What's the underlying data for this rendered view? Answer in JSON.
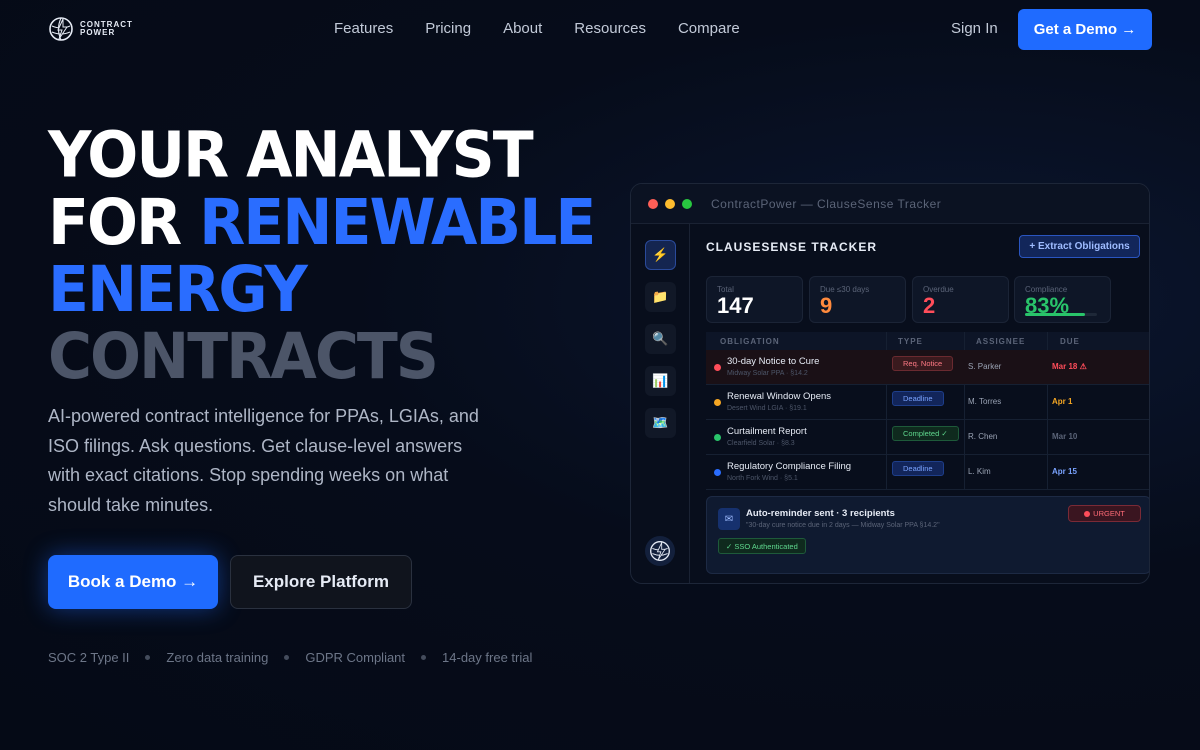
{
  "brand": {
    "line1": "CONTRACT",
    "line2": "POWER"
  },
  "nav": {
    "links": [
      "Features",
      "Pricing",
      "About",
      "Resources",
      "Compare"
    ],
    "sign_in": "Sign In",
    "demo_cta": "Get a Demo →"
  },
  "hero": {
    "line1": "YOUR ANALYST",
    "line2_a": "FOR ",
    "line2_b": "RENEWABLE",
    "line3": "ENERGY",
    "line4": "CONTRACTS",
    "subtext": "AI-powered contract intelligence for PPAs, LGIAs, and ISO filings. Ask questions. Get clause-level answers with exact citations. Stop spending weeks on what should take minutes.",
    "primary_cta": "Book a Demo →",
    "secondary_cta": "Explore Platform",
    "trust": [
      "SOC 2 Type II",
      "Zero data training",
      "GDPR Compliant",
      "14-day free trial"
    ]
  },
  "colors": {
    "accent": "#1f6bff",
    "danger": "#ff4d5a",
    "warning": "#f5a623",
    "success": "#29c46a"
  },
  "mockup": {
    "window_title": "ContractPower — ClauseSense Tracker",
    "sidebar_icons": [
      "lightning-icon",
      "folder-icon",
      "search-icon",
      "chart-icon",
      "map-icon"
    ],
    "sidebar_glyphs": [
      "⚡",
      "📁",
      "🔍",
      "📊",
      "🗺️"
    ],
    "title": "CLAUSESENSE TRACKER",
    "extract_button": "+ Extract Obligations",
    "stats": [
      {
        "label": "Total",
        "value": "147",
        "color": "#ffffff"
      },
      {
        "label": "Due ≤30 days",
        "value": "9",
        "color": "#ff8a3d"
      },
      {
        "label": "Overdue",
        "value": "2",
        "color": "#ff4d5a"
      },
      {
        "label": "Compliance",
        "value": "83%",
        "color": "#29c46a",
        "progress": 0.83
      }
    ],
    "columns": [
      "OBLIGATION",
      "TYPE",
      "ASSIGNEE",
      "DUE"
    ],
    "rows": [
      {
        "title": "30-day Notice to Cure",
        "sub": "Midway Solar PPA · §14.2",
        "type": "Req. Notice",
        "assignee": "S. Parker",
        "due": "Mar 18 ⚠",
        "dot": "#ff4d5a",
        "tag_bg": "#3a1a1e",
        "tag_border": "#6a2a30",
        "tag_fg": "#ff7a85",
        "due_color": "#ff4d5a",
        "highlight": true
      },
      {
        "title": "Renewal Window Opens",
        "sub": "Desert Wind LGIA · §19.1",
        "type": "Deadline",
        "assignee": "M. Torres",
        "due": "Apr 1",
        "dot": "#f5a623",
        "tag_bg": "#12255a",
        "tag_border": "#1e3e8a",
        "tag_fg": "#7aa3ff",
        "due_color": "#f5a623",
        "highlight": false
      },
      {
        "title": "Curtailment Report",
        "sub": "Clearfield Solar · §8.3",
        "type": "Completed ✓",
        "assignee": "R. Chen",
        "due": "Mar 10",
        "dot": "#29c46a",
        "tag_bg": "#0f2a1e",
        "tag_border": "#1e5a3a",
        "tag_fg": "#5fd88e",
        "due_color": "#5b6478",
        "highlight": false
      },
      {
        "title": "Regulatory Compliance Filing",
        "sub": "North Fork Wind · §5.1",
        "type": "Deadline",
        "assignee": "L. Kim",
        "due": "Apr 15",
        "dot": "#2a6dff",
        "tag_bg": "#12255a",
        "tag_border": "#1e3e8a",
        "tag_fg": "#7aa3ff",
        "due_color": "#7aa3ff",
        "highlight": false
      }
    ],
    "notice": {
      "title": "Auto-reminder sent · 3 recipients",
      "sub": "\"30-day cure notice due in 2 days — Midway Solar PPA §14.2\"",
      "urgent": "URGENT",
      "sso": "✓ SSO Authenticated"
    }
  }
}
